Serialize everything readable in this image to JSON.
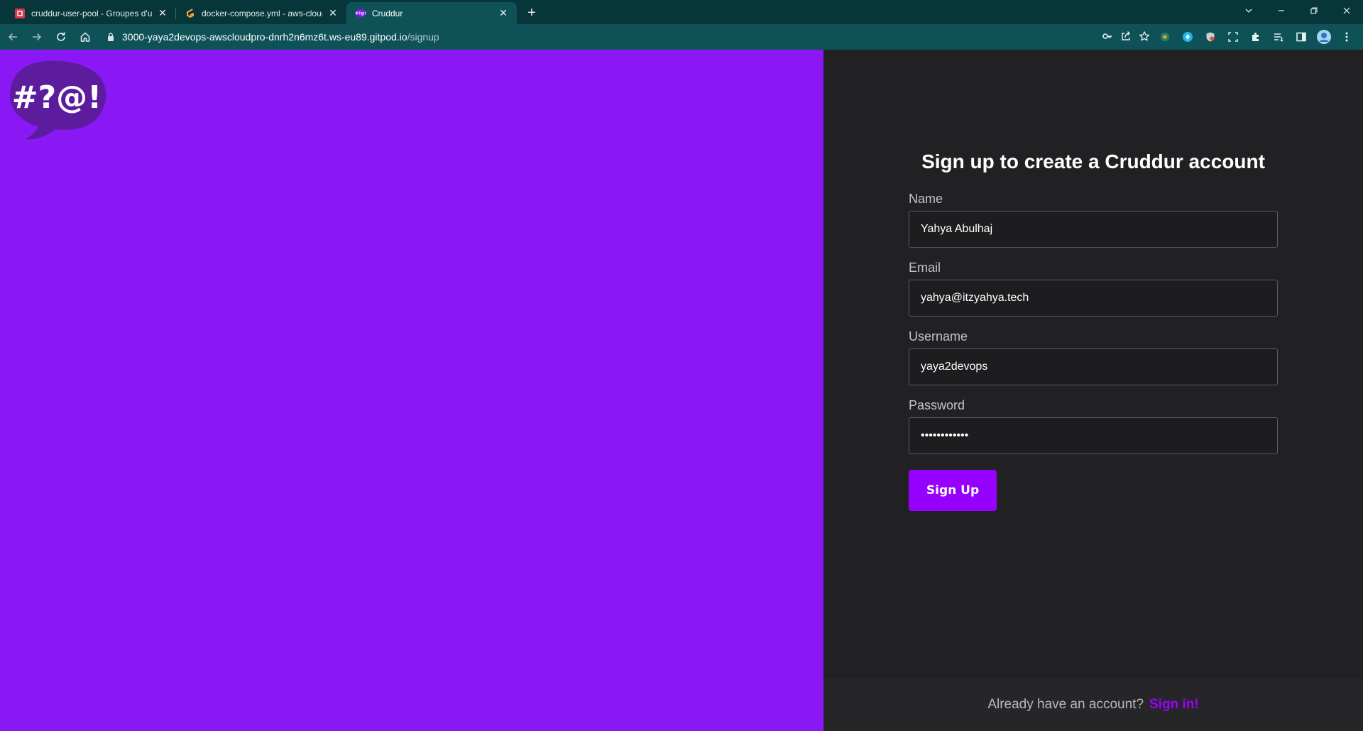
{
  "browser": {
    "tabs": [
      {
        "title": "cruddur-user-pool - Groupes d'u",
        "icon": "aws-cognito-icon",
        "active": false
      },
      {
        "title": "docker-compose.yml - aws-cloud",
        "icon": "gitpod-icon",
        "active": false
      },
      {
        "title": "Cruddur",
        "icon": "cruddur-icon",
        "active": true
      }
    ],
    "url_host": "3000-yaya2devops-awscloudpro-dnrh2n6mz6t.ws-eu89.gitpod.io",
    "url_path": "/signup"
  },
  "logo": {
    "text": "#?@!",
    "color": "#5d1b9e"
  },
  "colors": {
    "brand_panel": "#8918f5",
    "accent": "#9500ff",
    "background": "#212124"
  },
  "signup": {
    "title": "Sign up to create a Cruddur account",
    "fields": {
      "name": {
        "label": "Name",
        "value": "Yahya Abulhaj"
      },
      "email": {
        "label": "Email",
        "value": "yahya@itzyahya.tech"
      },
      "username": {
        "label": "Username",
        "value": "yaya2devops"
      },
      "password": {
        "label": "Password",
        "value": "••••••••••••"
      }
    },
    "submit_label": "Sign Up"
  },
  "footer": {
    "prompt": "Already have an account?",
    "link_label": "Sign in!"
  }
}
